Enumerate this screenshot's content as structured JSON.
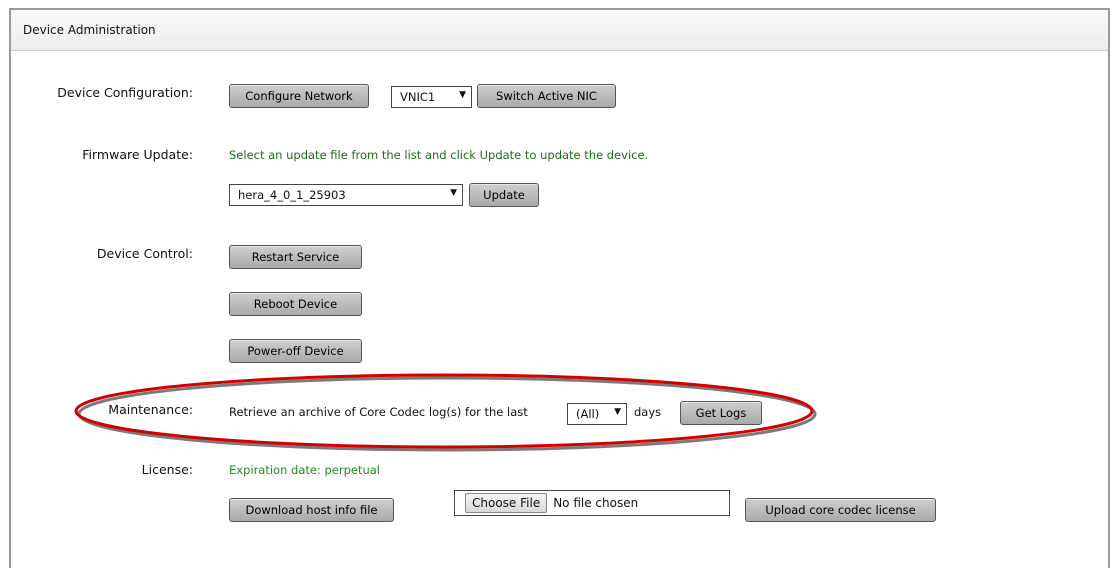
{
  "panel": {
    "title": "Device Administration"
  },
  "config": {
    "label": "Device Configuration:",
    "configure_network": "Configure Network",
    "nic_select": "VNIC1",
    "switch_nic": "Switch Active NIC"
  },
  "firmware": {
    "label": "Firmware Update:",
    "hint": "Select an update file from the list and click Update to update the device.",
    "file_select": "hera_4_0_1_25903",
    "update": "Update"
  },
  "control": {
    "label": "Device Control:",
    "restart": "Restart Service",
    "reboot": "Reboot Device",
    "poweroff": "Power-off Device"
  },
  "maintenance": {
    "label": "Maintenance:",
    "text": "Retrieve an archive of Core Codec log(s) for the last",
    "days_select": "(All)",
    "days": "days",
    "get_logs": "Get Logs",
    "highlight_color": "#d40000"
  },
  "license": {
    "label": "License:",
    "expiration": "Expiration date: perpetual",
    "download": "Download host info file",
    "choose_file": "Choose File",
    "no_file": "No file chosen",
    "upload": "Upload core codec license"
  }
}
